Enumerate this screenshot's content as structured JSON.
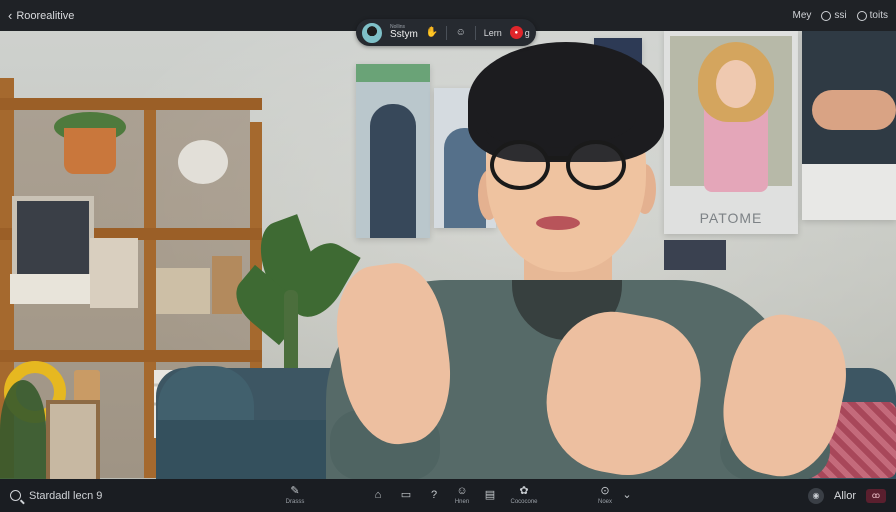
{
  "topbar": {
    "back_label": "Roorealitive",
    "right_items": [
      {
        "label": "Mey",
        "icon": "none"
      },
      {
        "label": "ssi",
        "icon": "circle-icon"
      },
      {
        "label": "toits",
        "icon": "circle-icon"
      }
    ]
  },
  "call_pill": {
    "subtitle": "Nollins",
    "name": "Sstym",
    "icons": [
      "hand-icon",
      "smile-icon"
    ],
    "label": "Lern",
    "record_badge": "g"
  },
  "scene": {
    "poster_caption": "PATOME"
  },
  "bottombar": {
    "search_label": "Stardadl lecn 9",
    "tools": [
      {
        "name": "draw",
        "glyph": "✎",
        "label": "Drasss"
      },
      {
        "name": "home",
        "glyph": "⌂",
        "label": ""
      },
      {
        "name": "chat",
        "glyph": "▭",
        "label": ""
      },
      {
        "name": "help",
        "glyph": "?",
        "label": ""
      },
      {
        "name": "emoji",
        "glyph": "☺",
        "label": "Hnen"
      },
      {
        "name": "screen",
        "glyph": "▤",
        "label": ""
      },
      {
        "name": "reactions",
        "glyph": "✿",
        "label": "Cococone"
      },
      {
        "name": "more",
        "glyph": "⊙",
        "label": "Noex"
      }
    ],
    "more_chevron": "⌄",
    "right_label": "Allor",
    "end_label": "ꝏ"
  },
  "colors": {
    "record": "#e0262b",
    "accent_ring": "#7fc0c8",
    "bar_bg": "#1f2226"
  }
}
